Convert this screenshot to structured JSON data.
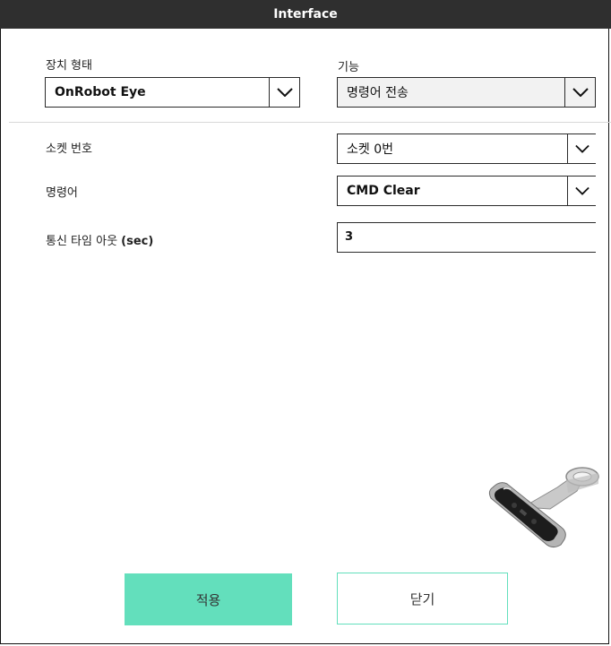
{
  "window": {
    "title": "Interface"
  },
  "device_type": {
    "label": "장치 형태",
    "value": "OnRobot Eye"
  },
  "function": {
    "label": "기능",
    "value": "명령어 전송"
  },
  "socket": {
    "label": "소켓 번호",
    "value": "소켓 0번"
  },
  "command": {
    "label": "명령어",
    "value": "CMD Clear"
  },
  "timeout": {
    "label": "통신 타임 아웃",
    "unit": "(sec)",
    "value": "3"
  },
  "buttons": {
    "apply": "적용",
    "close": "닫기"
  },
  "icons": {
    "dropdown": "chevron-down-icon",
    "device_image": "onrobot-eye-camera-image"
  },
  "colors": {
    "accent": "#63dfbc",
    "titlebar": "#2f2f2f"
  }
}
